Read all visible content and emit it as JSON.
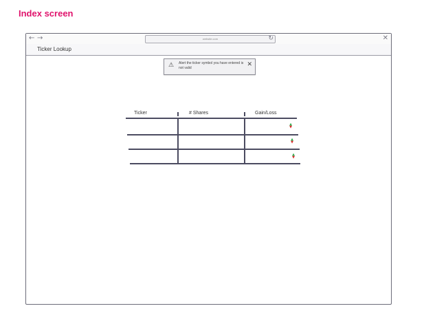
{
  "page_heading": "Index screen",
  "browser": {
    "back_icon": "←",
    "forward_icon": "→",
    "url": "website.com",
    "reload_icon": "↻",
    "close_icon": "✕"
  },
  "app": {
    "title": "Ticker Lookup"
  },
  "alert": {
    "icon": "⚠",
    "message": "Alert the ticker symbol you have entered is not valid",
    "close_icon": "✕"
  },
  "table": {
    "headers": [
      "Ticker",
      "# Shares",
      "Gain/Loss"
    ],
    "rows": [
      {
        "ticker": "",
        "shares": "",
        "gain_up": "▲",
        "gain_down": "▼"
      },
      {
        "ticker": "",
        "shares": "",
        "gain_up": "▲",
        "gain_down": "▼"
      },
      {
        "ticker": "",
        "shares": "",
        "gain_up": "▲",
        "gain_down": "▼"
      }
    ]
  },
  "colors": {
    "heading": "#e0136c",
    "gain_up": "#2eaa4a",
    "gain_down": "#d62b2b",
    "table_lines": "#4b4b60"
  }
}
